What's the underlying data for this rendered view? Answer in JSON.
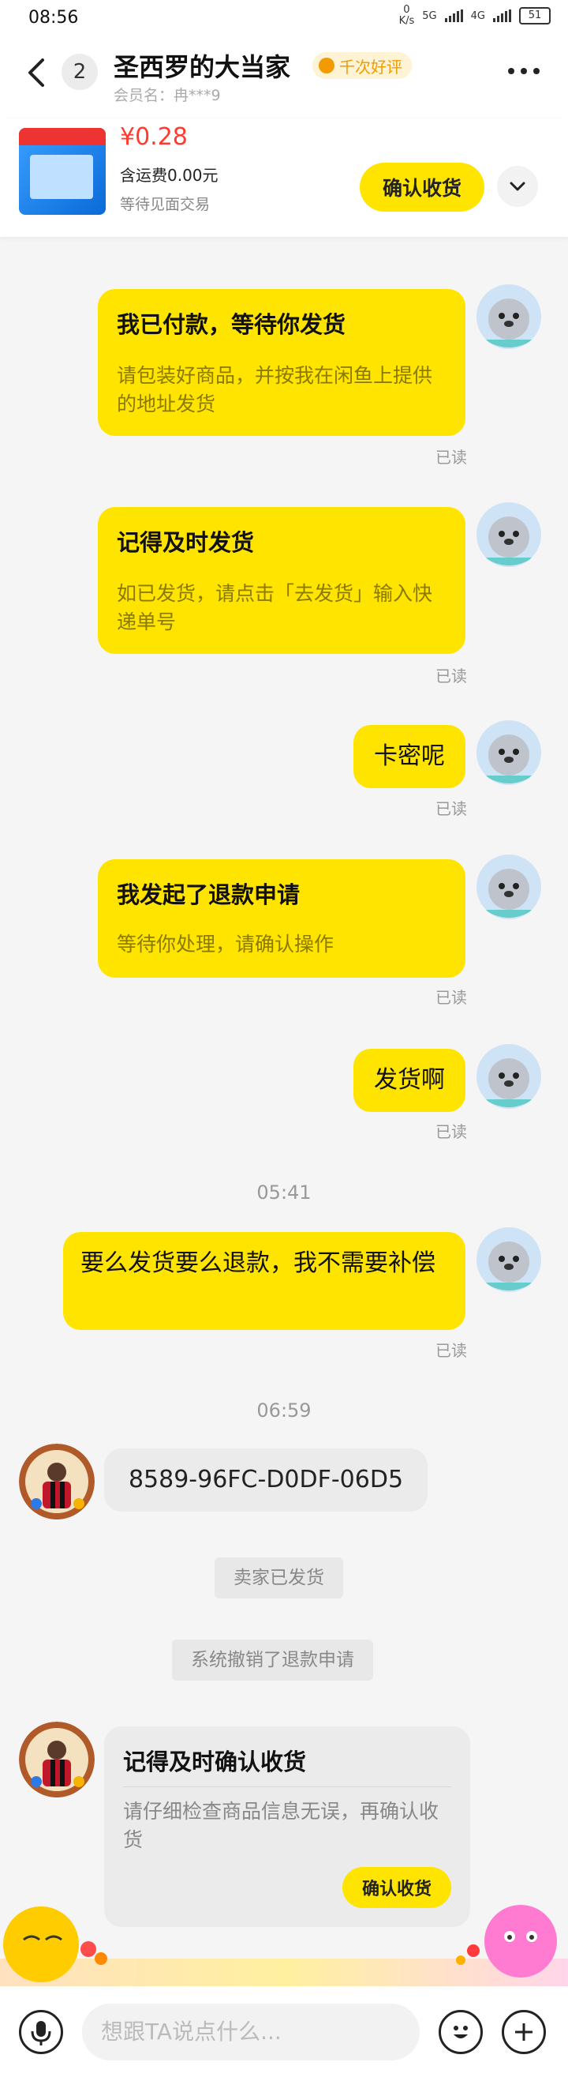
{
  "status_bar": {
    "time": "08:56",
    "net_speed_top": "0",
    "net_speed_unit": "K/s",
    "net1": "5G",
    "net2": "4G",
    "battery": "51"
  },
  "header": {
    "unread_count": "2",
    "shop_name": "圣西罗的大当家",
    "rating_badge": "千次好评",
    "member_label": "会员名：冉***9"
  },
  "product": {
    "price": "¥0.28",
    "shipping": "含运费0.00元",
    "status": "等待见面交易",
    "confirm_label": "确认收货"
  },
  "messages": {
    "m1": {
      "title": "我已付款，等待你发货",
      "body": "请包装好商品，并按我在闲鱼上提供的地址发货",
      "read": "已读"
    },
    "m2": {
      "title": "记得及时发货",
      "body": "如已发货，请点击「去发货」输入快递单号",
      "read": "已读"
    },
    "m3": {
      "text": "卡密呢",
      "read": "已读"
    },
    "m4": {
      "title": "我发起了退款申请",
      "body": "等待你处理，请确认操作",
      "read": "已读"
    },
    "m5": {
      "text": "发货啊",
      "read": "已读"
    },
    "ts1": "05:41",
    "m6": {
      "text": "要么发货要么退款，我不需要补偿",
      "read": "已读"
    },
    "ts2": "06:59",
    "m7": {
      "text": "8589-96FC-D0DF-06D5"
    },
    "sys1": "卖家已发货",
    "sys2": "系统撤销了退款申请",
    "m8": {
      "title": "记得及时确认收货",
      "body": "请仔细检查商品信息无误，再确认收货",
      "button": "确认收货"
    }
  },
  "input": {
    "placeholder": "想跟TA说点什么..."
  },
  "icons": [
    "back-icon",
    "more-icon",
    "chevron-down-icon",
    "voice-icon",
    "emoji-icon",
    "plus-icon"
  ],
  "colors": {
    "accent_yellow": "#ffe400",
    "price_red": "#ff3b30",
    "rating_orange": "#f29b00"
  }
}
